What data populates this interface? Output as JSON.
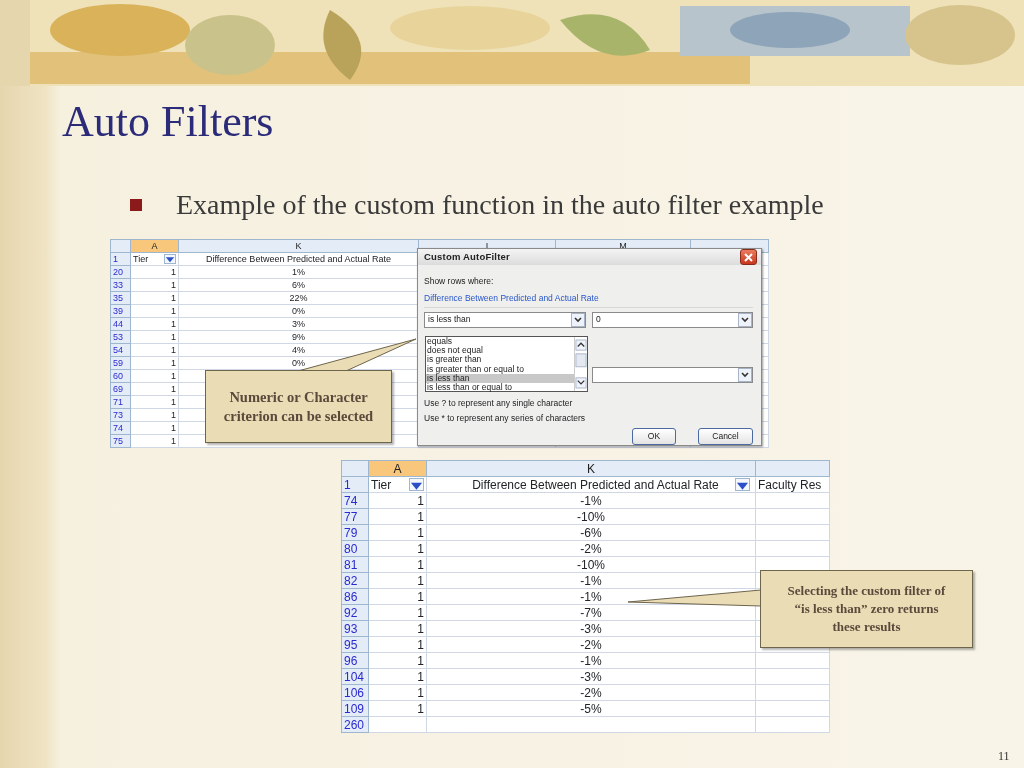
{
  "slide": {
    "title": "Auto Filters",
    "bullets": [
      "Example of the custom function in the auto filter example"
    ],
    "page_number": "11"
  },
  "sheet_1": {
    "columns": [
      {
        "label": "A",
        "active": true
      },
      {
        "label": "K",
        "active": false
      },
      {
        "label": "I",
        "active": false
      },
      {
        "label": "M",
        "active": false
      }
    ],
    "header": {
      "row": "1",
      "cells": [
        {
          "text": "Tier",
          "filter": true
        },
        {
          "text": "Difference Between Predicted and Actual Rate",
          "filter": false
        }
      ]
    },
    "rows": [
      {
        "row": "20",
        "tier": "1",
        "rate": "1%"
      },
      {
        "row": "33",
        "tier": "1",
        "rate": "6%"
      },
      {
        "row": "35",
        "tier": "1",
        "rate": "22%"
      },
      {
        "row": "39",
        "tier": "1",
        "rate": "0%"
      },
      {
        "row": "44",
        "tier": "1",
        "rate": "3%"
      },
      {
        "row": "53",
        "tier": "1",
        "rate": "9%"
      },
      {
        "row": "54",
        "tier": "1",
        "rate": "4%"
      },
      {
        "row": "59",
        "tier": "1",
        "rate": "0%"
      },
      {
        "row": "60",
        "tier": "1"
      },
      {
        "row": "69",
        "tier": "1"
      },
      {
        "row": "71",
        "tier": "1"
      },
      {
        "row": "73",
        "tier": "1"
      },
      {
        "row": "74",
        "tier": "1"
      },
      {
        "row": "75",
        "tier": "1"
      }
    ]
  },
  "dialog": {
    "title": "Custom AutoFilter",
    "prompt": "Show rows where:",
    "field": "Difference Between Predicted and Actual Rate",
    "operator": "is less than",
    "value": "0",
    "options": [
      {
        "label": "equals",
        "selected": false
      },
      {
        "label": "does not equal",
        "selected": false
      },
      {
        "label": "is greater than",
        "selected": false
      },
      {
        "label": "is greater than or equal to",
        "selected": false
      },
      {
        "label": "is less than",
        "selected": true
      },
      {
        "label": "is less than or equal to",
        "selected": false
      }
    ],
    "hints": [
      "Use ? to represent any single character",
      "Use * to represent any series of characters"
    ],
    "buttons": [
      "OK",
      "Cancel"
    ]
  },
  "sheet_2": {
    "columns": [
      {
        "label": "A",
        "active": true
      },
      {
        "label": "K",
        "active": false
      }
    ],
    "header": {
      "row": "1",
      "cells": [
        {
          "text": "Tier",
          "filter": true
        },
        {
          "text": "Difference Between Predicted and Actual Rate",
          "filter": true
        },
        {
          "text": "Faculty Res",
          "filter": false
        }
      ]
    },
    "rows": [
      {
        "row": "74",
        "tier": "1",
        "rate": "-1%"
      },
      {
        "row": "77",
        "tier": "1",
        "rate": "-10%"
      },
      {
        "row": "79",
        "tier": "1",
        "rate": "-6%"
      },
      {
        "row": "80",
        "tier": "1",
        "rate": "-2%"
      },
      {
        "row": "81",
        "tier": "1",
        "rate": "-10%"
      },
      {
        "row": "82",
        "tier": "1",
        "rate": "-1%"
      },
      {
        "row": "86",
        "tier": "1",
        "rate": "-1%"
      },
      {
        "row": "92",
        "tier": "1",
        "rate": "-7%"
      },
      {
        "row": "93",
        "tier": "1",
        "rate": "-3%"
      },
      {
        "row": "95",
        "tier": "1",
        "rate": "-2%"
      },
      {
        "row": "96",
        "tier": "1",
        "rate": "-1%"
      },
      {
        "row": "104",
        "tier": "1",
        "rate": "-3%"
      },
      {
        "row": "106",
        "tier": "1",
        "rate": "-2%"
      },
      {
        "row": "109",
        "tier": "1",
        "rate": "-5%"
      },
      {
        "row": "260"
      }
    ]
  },
  "callouts": [
    {
      "text": "Numeric or Character criterion can be selected"
    },
    {
      "text": "Selecting the custom filter of “is less than” zero returns these results"
    }
  ]
}
